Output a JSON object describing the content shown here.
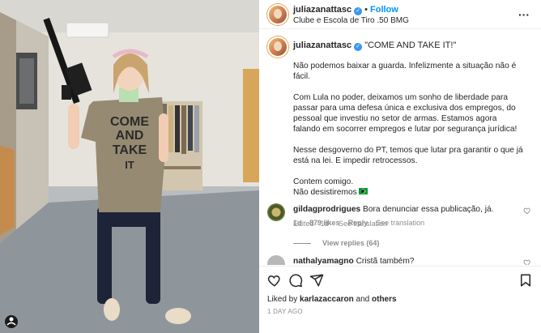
{
  "header": {
    "username": "juliazanattasc",
    "follow_label": "Follow",
    "location": "Clube e Escola de Tiro .50 BMG",
    "more_icon": "ellipsis-icon"
  },
  "photo": {
    "shirt_line1": "COME",
    "shirt_line2": "AND",
    "shirt_line3": "TAKE",
    "shirt_line4": "IT"
  },
  "caption": {
    "username": "juliazanattasc",
    "headline": "\"COME AND TAKE IT!\"",
    "paragraphs": [
      "Não podemos baixar a guarda. Infelizmente a situação não é fácil.",
      "Com Lula no poder, deixamos um sonho de liberdade para passar para uma defesa única e exclusiva dos empregos, do pessoal que investiu no setor de armas. Estamos agora falando em socorrer empregos e lutar por segurança jurídica!",
      "Nesse desgoverno do PT, temos que lutar pra garantir o que já está na lei. E impedir retrocessos.",
      "Contem comigo.",
      "Não desistiremos"
    ],
    "edited": "Edited · 1d",
    "see_translation": "See translation"
  },
  "comments": [
    {
      "username": "gildagprodrigues",
      "text": "Bora denunciar essa publicação, já.",
      "age": "1d",
      "likes": "879 likes",
      "reply": "Reply",
      "see_translation": "See translation",
      "view_replies": "View replies (64)"
    },
    {
      "username": "nathalyamagno",
      "text": "Cristã também?"
    }
  ],
  "actions": {
    "like_icon": "heart-icon",
    "comment_icon": "comment-icon",
    "share_icon": "share-icon",
    "save_icon": "bookmark-icon"
  },
  "likes": {
    "prefix": "Liked by",
    "user": "karlazaccaron",
    "conjunction": "and",
    "others": "others"
  },
  "post_date": "1 DAY AGO",
  "colors": {
    "accent": "#0095f6",
    "verified": "#3897f0",
    "muted_text": "#8e8e8e",
    "text": "#262626"
  }
}
